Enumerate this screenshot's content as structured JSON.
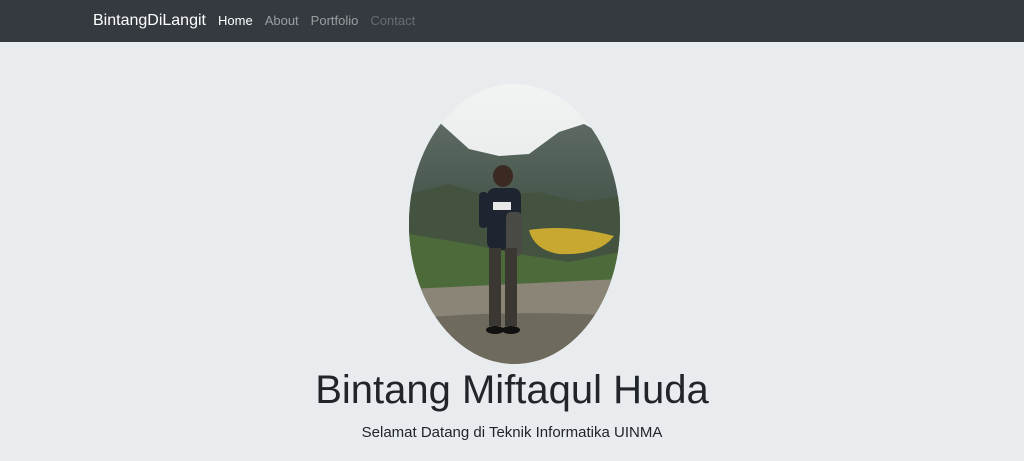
{
  "navbar": {
    "brand": "BintangDiLangit",
    "links": [
      {
        "label": "Home",
        "state": "active"
      },
      {
        "label": "About",
        "state": "normal"
      },
      {
        "label": "Portfolio",
        "state": "normal"
      },
      {
        "label": "Contact",
        "state": "disabled"
      }
    ]
  },
  "hero": {
    "photo": "profile-photo",
    "name": "Bintang Miftaqul Huda",
    "tagline": "Selamat Datang di Teknik Informatika UINMA"
  },
  "colors": {
    "navbar_bg": "#343a40",
    "page_bg": "#e9ecef",
    "text": "#212529"
  }
}
